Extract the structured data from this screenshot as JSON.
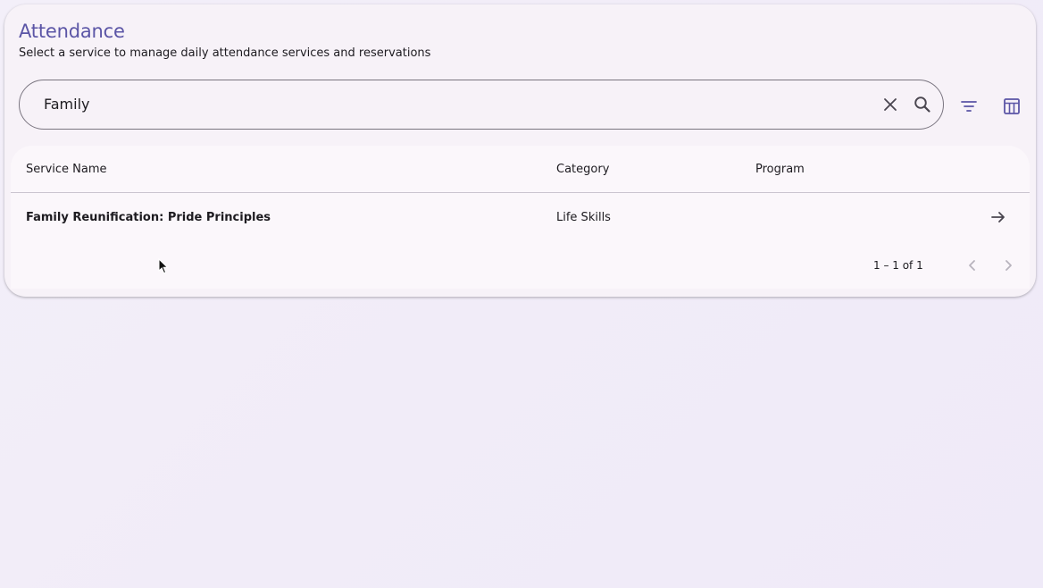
{
  "header": {
    "title": "Attendance",
    "subtitle": "Select a service to manage daily attendance services and reservations"
  },
  "search": {
    "value": "Family",
    "clear_icon": "close-icon",
    "search_icon": "search-icon"
  },
  "toolbar": {
    "filter_icon": "filter-list-icon",
    "columns_icon": "table-columns-icon"
  },
  "table": {
    "columns": [
      "Service Name",
      "Category",
      "Program"
    ],
    "rows": [
      {
        "service_name": "Family Reunification: Pride Principles",
        "category": "Life Skills",
        "program": "",
        "action_icon": "arrow-forward-icon"
      }
    ]
  },
  "paginator": {
    "range_label": "1 – 1 of 1",
    "prev_icon": "chevron-left-icon",
    "next_icon": "chevron-right-icon"
  },
  "colors": {
    "accent": "#5b55a6",
    "icon": "#49454f",
    "icon_accent": "#5b55a6",
    "disabled": "#b8b3bd",
    "background": "#f3eff9",
    "card": "#f7f2f8"
  }
}
